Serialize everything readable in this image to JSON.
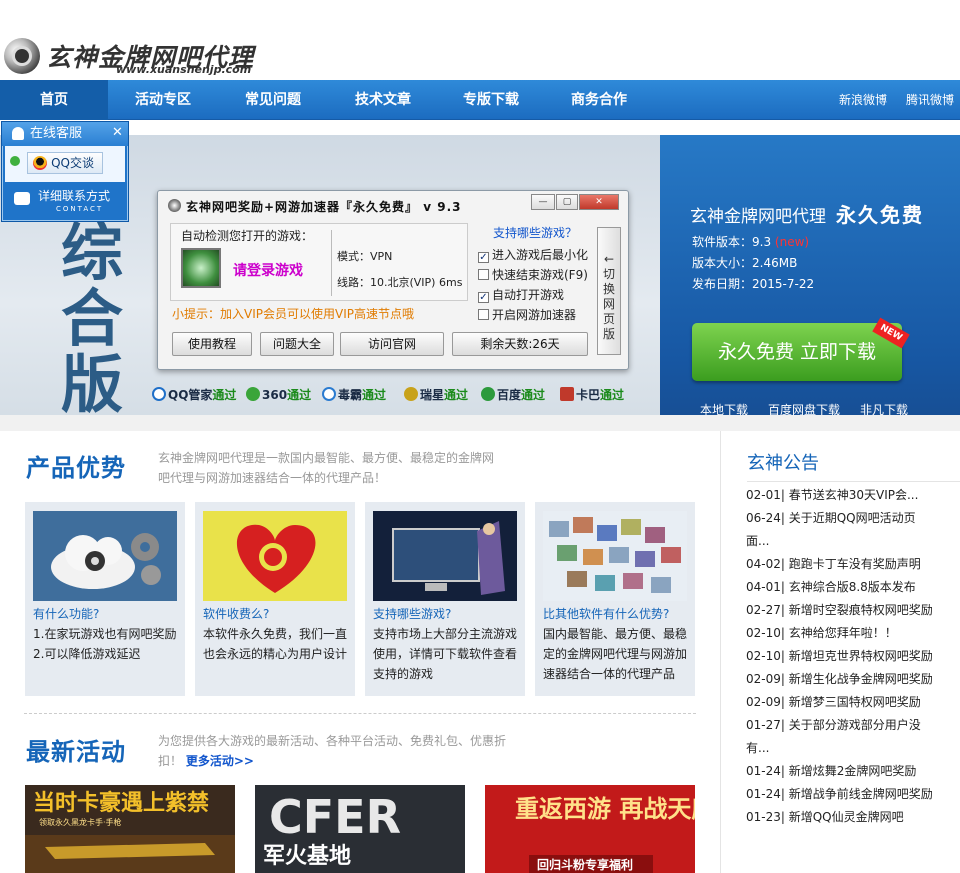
{
  "header": {
    "title": "玄神金牌网吧代理",
    "url": "www.xuanshenjp.com"
  },
  "nav": {
    "items": [
      "首页",
      "活动专区",
      "常见问题",
      "技术文章",
      "专版下载",
      "商务合作"
    ],
    "right": [
      "新浪微博",
      "腾讯微博"
    ]
  },
  "online_service": {
    "title": "在线客服",
    "close": "✕",
    "qq": "QQ交谈",
    "contact": "详细联系方式",
    "contact_en": "CONTACT"
  },
  "banner": {
    "big_glyphs": "综合版",
    "title": "玄神金牌网吧代理",
    "title_em": "永久免费",
    "version_label": "软件版本：9.3",
    "version_new": "(new)",
    "size": "版本大小：2.46MB",
    "date": "发布日期：2015-7-22",
    "download_btn": "永久免费  立即下载",
    "new_badge": "NEW",
    "links": [
      "本地下载",
      "百度网盘下载",
      "非凡下载"
    ]
  },
  "app_window": {
    "title": "玄神网吧奖励+网游加速器『永久免费』  v 9.3",
    "detect_label": "自动检测您打开的游戏：",
    "login_game": "请登录游戏",
    "mode": "模式：VPN",
    "line": "线路：10.北京(VIP) 6ms",
    "tip": "小提示：加入VIP会员可以使用VIP高速节点哦",
    "support": "支持哪些游戏？",
    "checks": [
      {
        "label": "进入游戏后最小化",
        "checked": true
      },
      {
        "label": "快速结束游戏(F9)",
        "checked": false
      },
      {
        "label": "自动打开游戏",
        "checked": true
      },
      {
        "label": "开启网游加速器",
        "checked": false
      }
    ],
    "switch": "←切换网页版",
    "buttons": [
      "使用教程",
      "问题大全",
      "访问官网",
      "剩余天数:26天"
    ]
  },
  "av_badges": [
    {
      "name": "QQ管家",
      "pass": "通过",
      "color": "#1e6fc8"
    },
    {
      "name": "360",
      "pass": "通过",
      "color": "#3aa53a"
    },
    {
      "name": "毒霸",
      "pass": "通过",
      "color": "#2a7bd0"
    },
    {
      "name": "瑞星",
      "pass": "通过",
      "color": "#c8a21a"
    },
    {
      "name": "百度",
      "pass": "通过",
      "color": "#2c9a3c"
    },
    {
      "name": "卡巴",
      "pass": "通过",
      "color": "#c0392b"
    }
  ],
  "product": {
    "title": "产品优势",
    "desc": "玄神金牌网吧代理是一款国内最智能、最方便、最稳定的金牌网吧代理与网游加速器结合一体的代理产品！",
    "cards": [
      {
        "title": "有什么功能?",
        "lines": [
          "1.在家玩游戏也有网吧奖励",
          "2.可以降低游戏延迟"
        ]
      },
      {
        "title": "软件收费么?",
        "lines": [
          "本软件永久免费，我们一直也会永远的精心为用户设计"
        ]
      },
      {
        "title": "支持哪些游戏?",
        "lines": [
          "支持市场上大部分主流游戏使用，详情可下载软件查看支持的游戏"
        ]
      },
      {
        "title": "比其他软件有什么优势?",
        "lines": [
          "国内最智能、最方便、最稳定的金牌网吧代理与网游加速器结合一体的代理产品"
        ]
      }
    ]
  },
  "activity": {
    "title": "最新活动",
    "desc": "为您提供各大游戏的最新活动、各种平台活动、免费礼包、优惠折扣！",
    "more": "更多活动>>",
    "banners": [
      {
        "text": "当时卡豪遇上紫禁",
        "sub": "领取永久黑龙卡手·手枪"
      },
      {
        "text": "CFER",
        "sub": "军火基地"
      },
      {
        "text": "重返西游 再战天庭",
        "sub": "回归斗粉专享福利"
      }
    ]
  },
  "notice": {
    "title": "玄神公告",
    "items": [
      "02-01| 春节送玄神30天VIP会...",
      "06-24| 关于近期QQ网吧活动页面...",
      "04-02| 跑跑卡丁车没有奖励声明",
      "04-01| 玄神综合版8.8版本发布",
      "02-27| 新增时空裂痕特权网吧奖励",
      "02-10| 玄神给您拜年啦！！",
      "02-10| 新增坦克世界特权网吧奖励",
      "02-09| 新增生化战争金牌网吧奖励",
      "02-09| 新增梦三国特权网吧奖励",
      "01-27| 关于部分游戏部分用户没有...",
      "01-24| 新增炫舞2金牌网吧奖励",
      "01-24| 新增战争前线金牌网吧奖励",
      "01-23| 新增QQ仙灵金牌网吧"
    ]
  }
}
